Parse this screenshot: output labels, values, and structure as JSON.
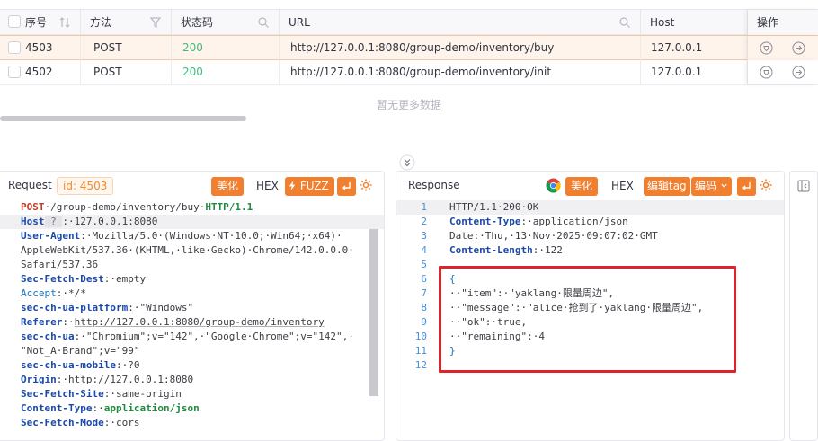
{
  "table": {
    "columns": [
      {
        "label": "序号",
        "icon": "sort-icon"
      },
      {
        "label": "方法",
        "icon": "filter-icon"
      },
      {
        "label": "状态码",
        "icon": "search-icon"
      },
      {
        "label": "URL",
        "icon": "search-icon"
      },
      {
        "label": "Host"
      },
      {
        "label": "操作"
      }
    ],
    "rows": [
      {
        "id": "4503",
        "method": "POST",
        "status": "200",
        "url": "http://127.0.0.1:8080/group-demo/inventory/buy",
        "host": "127.0.0.1"
      },
      {
        "id": "4502",
        "method": "POST",
        "status": "200",
        "url": "http://127.0.0.1:8080/group-demo/inventory/init",
        "host": "127.0.0.1"
      }
    ],
    "empty_text": "暂无更多数据"
  },
  "request": {
    "title": "Request",
    "id_tag": "id: 4503",
    "beautify": "美化",
    "hex": "HEX",
    "fuzz": "FUZZ",
    "lines": {
      "l1a": "POST",
      "l1b": "·/group-demo/inventory/buy·",
      "l1c": "HTTP/1.1",
      "l2a": "Host",
      "l2b": " ? ",
      "l2c": ":·127.0.0.1:8080",
      "l3a": "User-Agent",
      "l3b": ":·Mozilla/5.0·(Windows·NT·10.0;·Win64;·x64)·",
      "l4": "AppleWebKit/537.36·(KHTML,·like·Gecko)·Chrome/142.0.0.0·",
      "l5": "Safari/537.36",
      "l6a": "Sec-Fetch-Dest",
      "l6b": ":·empty",
      "l7a": "Accept",
      "l7b": ":·*/*",
      "l8a": "sec-ch-ua-platform",
      "l8b": ":·\"Windows\"",
      "l9a": "Referer",
      "l9b": ":·",
      "l9c": "http://127.0.0.1:8080/group-demo/inventory",
      "l10a": "sec-ch-ua",
      "l10b": ":·\"Chromium\";v=\"142\",·\"Google·Chrome\";v=\"142\",·",
      "l11": "\"Not_A·Brand\";v=\"99\"",
      "l12a": "sec-ch-ua-mobile",
      "l12b": ":·?0",
      "l13a": "Origin",
      "l13b": ":·",
      "l13c": "http://127.0.0.1:8080",
      "l14a": "Sec-Fetch-Site",
      "l14b": ":·same-origin",
      "l15a": "Content-Type",
      "l15b": ":·",
      "l15c": "application/json",
      "l16a": "Sec-Fetch-Mode",
      "l16b": ":·cors"
    }
  },
  "response": {
    "title": "Response",
    "beautify": "美化",
    "hex": "HEX",
    "edit_tag": "编辑tag",
    "encode": "编码",
    "lines": [
      {
        "n": "1",
        "t": "HTTP/1.1·200·OK"
      },
      {
        "n": "2",
        "k": "Content-Type",
        "t": ":·application/json"
      },
      {
        "n": "3",
        "t": "Date:·Thu,·13·Nov·2025·09:07:02·GMT"
      },
      {
        "n": "4",
        "k": "Content-Length",
        "t": ":·122"
      },
      {
        "n": "5",
        "t": ""
      },
      {
        "n": "6",
        "t": "{"
      },
      {
        "n": "7",
        "t": "··\"item\":·\"yaklang·限量周边\","
      },
      {
        "n": "8",
        "t": "··\"message\":·\"alice·抢到了·yaklang·限量周边\","
      },
      {
        "n": "9",
        "t": "··\"ok\":·true,"
      },
      {
        "n": "10",
        "t": "··\"remaining\":·4"
      },
      {
        "n": "11",
        "t": "}"
      },
      {
        "n": "12",
        "t": ""
      }
    ]
  },
  "colors": {
    "accent": "#f17f30",
    "status_ok": "#3dbd7d",
    "highlight_box": "#e0232b"
  }
}
